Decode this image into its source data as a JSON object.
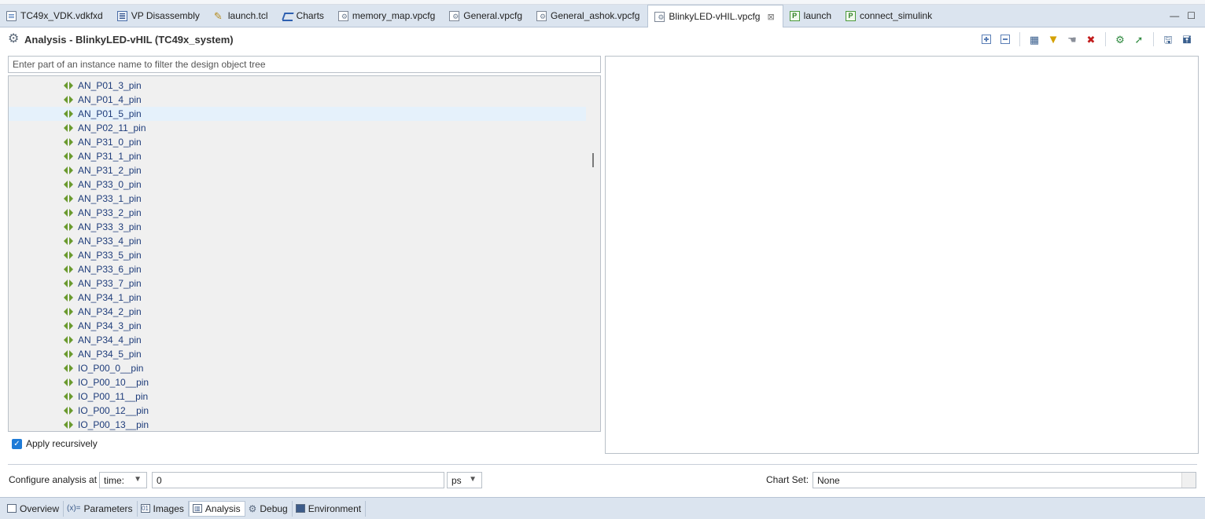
{
  "tabs": [
    {
      "label": "TC49x_VDK.vdkfxd",
      "icon": "document-icon",
      "active": false
    },
    {
      "label": "VP Disassembly",
      "icon": "disassembly-icon",
      "active": false
    },
    {
      "label": "launch.tcl",
      "icon": "tcl-script-icon",
      "active": false
    },
    {
      "label": "Charts",
      "icon": "chart-icon",
      "active": false
    },
    {
      "label": "memory_map.vpcfg",
      "icon": "config-file-icon",
      "active": false
    },
    {
      "label": "General.vpcfg",
      "icon": "config-file-icon",
      "active": false
    },
    {
      "label": "General_ashok.vpcfg",
      "icon": "config-file-icon",
      "active": false
    },
    {
      "label": "BlinkyLED-vHIL.vpcfg",
      "icon": "config-file-icon",
      "active": true
    },
    {
      "label": "launch",
      "icon": "python-file-icon",
      "active": false
    },
    {
      "label": "connect_simulink",
      "icon": "python-file-icon",
      "active": false
    }
  ],
  "header": {
    "title": "Analysis - BlinkyLED-vHIL (TC49x_system)"
  },
  "filter": {
    "placeholder": "Enter part of an instance name to filter the design object tree"
  },
  "tree": {
    "items": [
      "AN_P01_3_pin",
      "AN_P01_4_pin",
      "AN_P01_5_pin",
      "AN_P02_11_pin",
      "AN_P31_0_pin",
      "AN_P31_1_pin",
      "AN_P31_2_pin",
      "AN_P33_0_pin",
      "AN_P33_1_pin",
      "AN_P33_2_pin",
      "AN_P33_3_pin",
      "AN_P33_4_pin",
      "AN_P33_5_pin",
      "AN_P33_6_pin",
      "AN_P33_7_pin",
      "AN_P34_1_pin",
      "AN_P34_2_pin",
      "AN_P34_3_pin",
      "AN_P34_4_pin",
      "AN_P34_5_pin",
      "IO_P00_0__pin",
      "IO_P00_10__pin",
      "IO_P00_11__pin",
      "IO_P00_12__pin",
      "IO_P00_13__pin"
    ],
    "selected_index": 2
  },
  "apply_recursively": {
    "label": "Apply recursively",
    "checked": true
  },
  "configure": {
    "label": "Configure analysis at",
    "mode": "time:",
    "value": "0",
    "unit": "ps"
  },
  "chart_set": {
    "label": "Chart Set:",
    "value": "None"
  },
  "bottom_tabs": [
    {
      "label": "Overview",
      "icon": "overview-icon",
      "active": false
    },
    {
      "label": "Parameters",
      "icon": "parameters-icon",
      "active": false
    },
    {
      "label": "Images",
      "icon": "images-icon",
      "active": false
    },
    {
      "label": "Analysis",
      "icon": "analysis-icon",
      "active": true
    },
    {
      "label": "Debug",
      "icon": "debug-icon",
      "active": false
    },
    {
      "label": "Environment",
      "icon": "environment-icon",
      "active": false
    }
  ],
  "colors": {
    "accent": "#1e7bd7",
    "pin_icon": "#6a9a2e",
    "tree_text": "#1e3c7a"
  }
}
